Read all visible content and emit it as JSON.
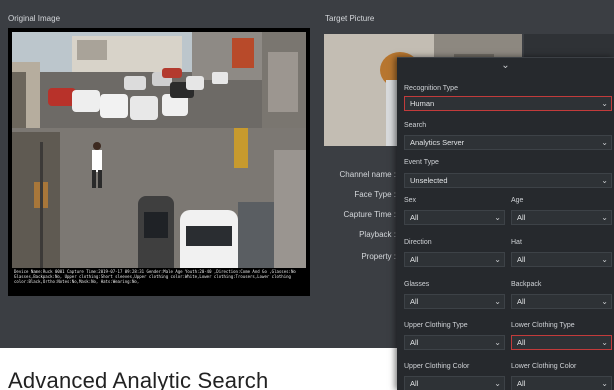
{
  "original": {
    "title": "Original Image",
    "overlay": "Device Name:Ruck 0001  Capture Time:2019-07-17 09:28:31 Gender:Male Age Youth:20-40 ,Direction:Come And Go ,Glasses:No Glasses,Backpack:No, Upper clothing:Short sleeves,Upper clothing color:White,Lower clothing:Trousers,Lower clothing color:Black,Ortho:Notes:No,Mask:No, Hats:Wearing:No,"
  },
  "target": {
    "title": "Target Picture"
  },
  "details": [
    "Channel name :",
    "Face Type :",
    "Capture Time :",
    "Playback :",
    "Property :"
  ],
  "heading": "Advanced Analytic Search",
  "filter": {
    "collapse_glyph": "⌄",
    "chevron_glyph": "⌄",
    "recognition_type": {
      "label": "Recognition Type",
      "value": "Human"
    },
    "search": {
      "label": "Search",
      "value": "Analytics Server"
    },
    "event_type": {
      "label": "Event Type",
      "value": "Unselected"
    },
    "sex": {
      "label": "Sex",
      "value": "All"
    },
    "age": {
      "label": "Age",
      "value": "All"
    },
    "direction": {
      "label": "Direction",
      "value": "All"
    },
    "hat": {
      "label": "Hat",
      "value": "All"
    },
    "glasses": {
      "label": "Glasses",
      "value": "All"
    },
    "backpack": {
      "label": "Backpack",
      "value": "All"
    },
    "upper_type": {
      "label": "Upper Clothing Type",
      "value": "All"
    },
    "lower_type": {
      "label": "Lower Clothing Type",
      "value": "All"
    },
    "upper_color": {
      "label": "Upper Clothing Color",
      "value": "All"
    },
    "lower_color": {
      "label": "Lower Clothing Color",
      "value": "All"
    }
  },
  "colors": {
    "panel_bg": "#26292d",
    "app_bg": "#3b3e43",
    "active_border": "#c23b3b"
  }
}
